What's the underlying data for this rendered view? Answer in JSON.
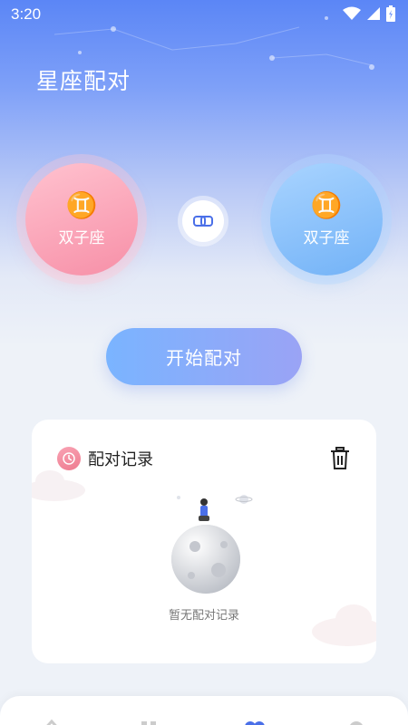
{
  "status_bar": {
    "time": "3:20"
  },
  "header": {
    "title": "星座配对"
  },
  "signs": {
    "left": {
      "glyph": "♊",
      "name": "双子座",
      "color": "#f78fa7"
    },
    "right": {
      "glyph": "♊",
      "name": "双子座",
      "color": "#72b2f7"
    }
  },
  "actions": {
    "start_label": "开始配对"
  },
  "records": {
    "title": "配对记录",
    "empty_text": "暂无配对记录"
  },
  "colors": {
    "accent": "#5b86f6",
    "pink": "#f78fa7",
    "blue": "#72b2f7"
  }
}
